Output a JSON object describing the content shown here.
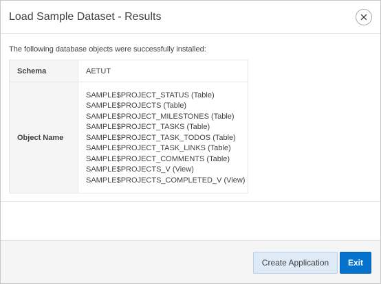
{
  "dialog": {
    "title": "Load Sample Dataset - Results",
    "close_icon": "close-icon"
  },
  "body": {
    "intro_text": "The following database objects were successfully installed:",
    "schema_label": "Schema",
    "schema_value": "AETUT",
    "object_name_label": "Object Name",
    "objects": [
      "SAMPLE$PROJECT_STATUS (Table)",
      "SAMPLE$PROJECTS (Table)",
      "SAMPLE$PROJECT_MILESTONES (Table)",
      "SAMPLE$PROJECT_TASKS (Table)",
      "SAMPLE$PROJECT_TASK_TODOS (Table)",
      "SAMPLE$PROJECT_TASK_LINKS (Table)",
      "SAMPLE$PROJECT_COMMENTS (Table)",
      "SAMPLE$PROJECTS_V (View)",
      "SAMPLE$PROJECTS_COMPLETED_V (View)"
    ]
  },
  "footer": {
    "create_application_label": "Create Application",
    "exit_label": "Exit"
  },
  "colors": {
    "primary_button": "#0572ce",
    "secondary_button": "#dfeaf7",
    "label_cell_bg": "#f5f5f5",
    "text": "#404040"
  }
}
